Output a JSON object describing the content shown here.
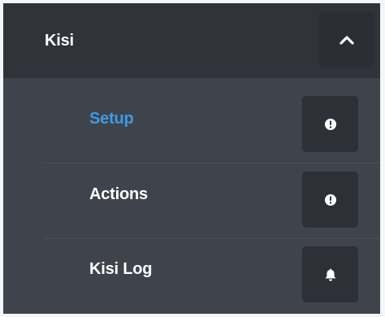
{
  "header": {
    "title": "Kisi",
    "toggle_icon": "chevron-up-icon"
  },
  "items": [
    {
      "label": "Setup",
      "icon": "exclamation-circle-icon",
      "active": true
    },
    {
      "label": "Actions",
      "icon": "exclamation-circle-icon",
      "active": false
    },
    {
      "label": "Kisi Log",
      "icon": "bell-icon",
      "active": false
    }
  ],
  "colors": {
    "panel_bg": "#3f434b",
    "header_bg": "#30333a",
    "button_bg": "#2d3036",
    "active_text": "#3d9ae8",
    "text": "#ffffff"
  }
}
